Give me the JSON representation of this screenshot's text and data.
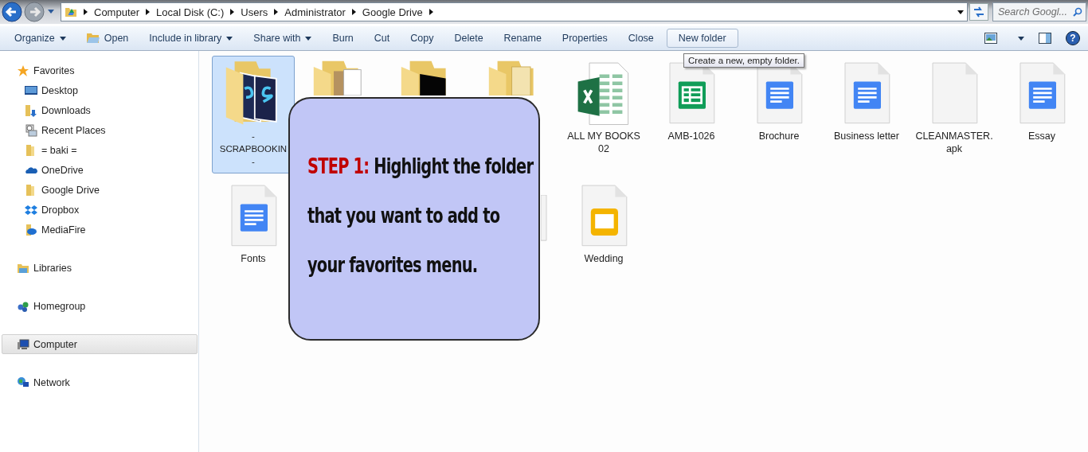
{
  "address_bar": {
    "path": [
      "Computer",
      "Local Disk (C:)",
      "Users",
      "Administrator",
      "Google Drive"
    ],
    "search_placeholder": "Search Googl..."
  },
  "toolbar": {
    "items": [
      {
        "label": "Organize",
        "dropdown": true,
        "hovered": false
      },
      {
        "label": "Open",
        "dropdown": false,
        "hovered": false
      },
      {
        "label": "Include in library",
        "dropdown": true,
        "hovered": false
      },
      {
        "label": "Share with",
        "dropdown": true,
        "hovered": false
      },
      {
        "label": "Burn",
        "dropdown": false,
        "hovered": false
      },
      {
        "label": "Cut",
        "dropdown": false,
        "hovered": false
      },
      {
        "label": "Copy",
        "dropdown": false,
        "hovered": false
      },
      {
        "label": "Delete",
        "dropdown": false,
        "hovered": false
      },
      {
        "label": "Rename",
        "dropdown": false,
        "hovered": false
      },
      {
        "label": "Properties",
        "dropdown": false,
        "hovered": false
      },
      {
        "label": "Close",
        "dropdown": false,
        "hovered": false
      },
      {
        "label": "New folder",
        "dropdown": false,
        "hovered": true
      }
    ],
    "help": "?"
  },
  "tooltip": "Create a new, empty folder.",
  "sidebar": {
    "groups": [
      {
        "label": "Favorites",
        "selected": false,
        "children": [
          {
            "label": "Desktop",
            "selected": false
          },
          {
            "label": "Downloads",
            "selected": false
          },
          {
            "label": "Recent Places",
            "selected": false
          },
          {
            "label": "= baki =",
            "selected": false
          },
          {
            "label": "OneDrive",
            "selected": false
          },
          {
            "label": "Google Drive",
            "selected": false
          },
          {
            "label": "Dropbox",
            "selected": false
          },
          {
            "label": "MediaFire",
            "selected": false
          }
        ]
      },
      {
        "label": "Libraries",
        "selected": false
      },
      {
        "label": "Homegroup",
        "selected": false
      },
      {
        "label": "Computer",
        "selected": true
      },
      {
        "label": "Network",
        "selected": false
      }
    ]
  },
  "files": [
    {
      "kind": "folder-ps",
      "label": "-\nSCRAPBOOKIN\n-",
      "selected": true
    },
    {
      "kind": "folder-paper",
      "selected": false
    },
    {
      "kind": "folder-dark",
      "selected": false
    },
    {
      "kind": "folder-pages",
      "selected": false
    },
    {
      "kind": "excel",
      "label": "ALL MY BOOKS 02",
      "selected": false
    },
    {
      "kind": "sheet",
      "label": "AMB-1026",
      "selected": false
    },
    {
      "kind": "doc",
      "label": "Brochure",
      "selected": false
    },
    {
      "kind": "doc",
      "label": "Business letter",
      "selected": false
    },
    {
      "kind": "blank",
      "label": "CLEANMASTER.\napk",
      "selected": false
    },
    {
      "kind": "doc",
      "label": "Essay",
      "selected": false
    },
    {
      "kind": "doc",
      "label": "Fonts",
      "selected": false
    },
    {
      "kind": "covered"
    },
    {
      "kind": "covered"
    },
    {
      "kind": "blank",
      "selected": false
    },
    {
      "kind": "slides",
      "label": "Wedding",
      "selected": false
    }
  ],
  "callout": {
    "step": "STEP 1:",
    "text": "Highlight the folder that you want to add to your favorites menu."
  }
}
